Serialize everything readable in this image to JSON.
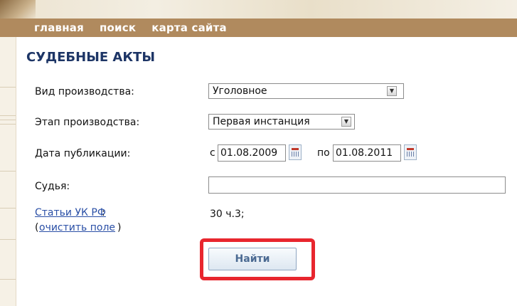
{
  "nav": {
    "items": [
      "главная",
      "поиск",
      "карта сайта"
    ]
  },
  "page": {
    "title": "СУДЕБНЫЕ АКТЫ"
  },
  "form": {
    "proceeding_type": {
      "label": "Вид производства:",
      "value": "Уголовное"
    },
    "proceeding_stage": {
      "label": "Этап производства:",
      "value": "Первая инстанция"
    },
    "publication_date": {
      "label": "Дата публикации:",
      "from_prefix": "с",
      "from_value": "01.08.2009",
      "to_prefix": "по",
      "to_value": "01.08.2011"
    },
    "judge": {
      "label": "Судья:",
      "value": ""
    },
    "criminal_code": {
      "link_label": "Статьи УК РФ",
      "label_suffix": ":",
      "paren_open": "(",
      "clear_link": "очистить поле",
      "paren_close": ")",
      "value": "30 ч.3;"
    },
    "submit_label": "Найти"
  },
  "colors": {
    "nav_bg": "#b08a5e",
    "title": "#1d3566",
    "link": "#2a4fa6",
    "highlight": "#e8262e"
  },
  "icons": {
    "dropdown": "chevron-down-icon",
    "calendar": "calendar-icon"
  }
}
